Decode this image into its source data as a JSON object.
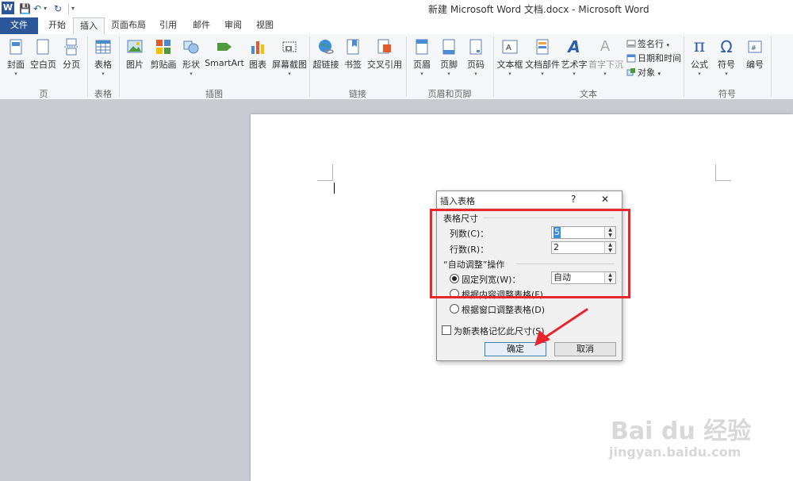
{
  "window": {
    "title": "新建 Microsoft Word 文档.docx - Microsoft Word"
  },
  "qat": {
    "app_letter": "W",
    "save": "💾",
    "undo": "↶",
    "redo": "↻",
    "more": "▾"
  },
  "tabs": [
    {
      "label": "文件"
    },
    {
      "label": "开始"
    },
    {
      "label": "插入"
    },
    {
      "label": "页面布局"
    },
    {
      "label": "引用"
    },
    {
      "label": "邮件"
    },
    {
      "label": "审阅"
    },
    {
      "label": "视图"
    }
  ],
  "ribbon": {
    "groups": [
      {
        "label": "页"
      },
      {
        "label": "表格"
      },
      {
        "label": "插图"
      },
      {
        "label": "链接"
      },
      {
        "label": "页眉和页脚"
      },
      {
        "label": "文本"
      },
      {
        "label": "符号"
      }
    ],
    "buttons": {
      "cover": "封面",
      "blank_page": "空白页",
      "page_break": "分页",
      "table": "表格",
      "picture": "图片",
      "clipart": "剪贴画",
      "shapes": "形状",
      "smartart": "SmartArt",
      "chart": "图表",
      "screenshot": "屏幕截图",
      "hyperlink": "超链接",
      "bookmark": "书签",
      "cross_ref": "交叉引用",
      "header": "页眉",
      "footer": "页脚",
      "page_number": "页码",
      "textbox": "文本框",
      "quick_parts": "文档部件",
      "wordart": "艺术字",
      "dropcap": "首字下沉",
      "signature_line": "签名行",
      "datetime": "日期和时间",
      "object": "对象",
      "equation": "公式",
      "symbol": "符号",
      "numbering": "编号"
    },
    "glyphs": {
      "equation": "π",
      "symbol": "Ω",
      "wordart": "A",
      "dropcap": "A"
    }
  },
  "dialog": {
    "title": "插入表格",
    "help": "?",
    "close": "✕",
    "section_size": "表格尺寸",
    "cols_label": "列数(C)：",
    "cols_value": "5",
    "rows_label": "行数(R)：",
    "rows_value": "2",
    "section_autofit": "“自动调整”操作",
    "fixed_width_label": "固定列宽(W)：",
    "fixed_width_value": "自动",
    "autofit_content": "根据内容调整表格(F)",
    "autofit_window": "根据窗口调整表格(D)",
    "remember": "为新表格记忆此尺寸(S)",
    "ok": "确定",
    "cancel": "取消"
  },
  "watermark": {
    "brand": "Bai du 经验",
    "url": "jingyan.baidu.com"
  }
}
